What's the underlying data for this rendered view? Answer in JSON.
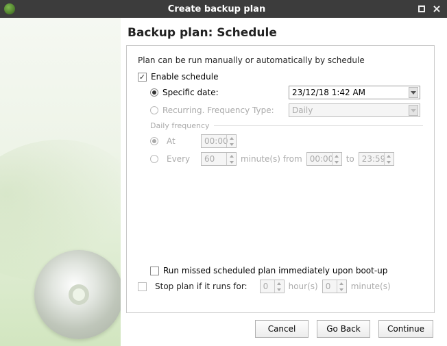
{
  "titlebar": {
    "title": "Create backup plan"
  },
  "page": {
    "heading": "Backup plan: Schedule"
  },
  "intro": "Plan can be run manually or automatically by schedule",
  "enable_schedule": {
    "label": "Enable schedule",
    "checked": true
  },
  "specific_date": {
    "label": "Specific date:",
    "value": "23/12/18 1:42 AM",
    "selected": true
  },
  "recurring": {
    "label": "Recurring. Frequency Type:",
    "value": "Daily",
    "selected": false
  },
  "daily_frequency": {
    "legend": "Daily frequency",
    "at": {
      "label": "At",
      "value": "00:00",
      "selected": true
    },
    "every": {
      "label": "Every",
      "value": "60",
      "unit": "minute(s) from",
      "from": "00:00",
      "to_label": "to",
      "to": "23:59",
      "selected": false
    }
  },
  "run_missed": {
    "label": "Run missed scheduled plan immediately upon boot-up",
    "checked": false
  },
  "stop_plan": {
    "label": "Stop plan if it runs for:",
    "hours": "0",
    "hours_label": "hour(s)",
    "minutes": "0",
    "minutes_label": "minute(s)",
    "checked": false
  },
  "buttons": {
    "cancel": "Cancel",
    "go_back": "Go Back",
    "continue": "Continue"
  }
}
